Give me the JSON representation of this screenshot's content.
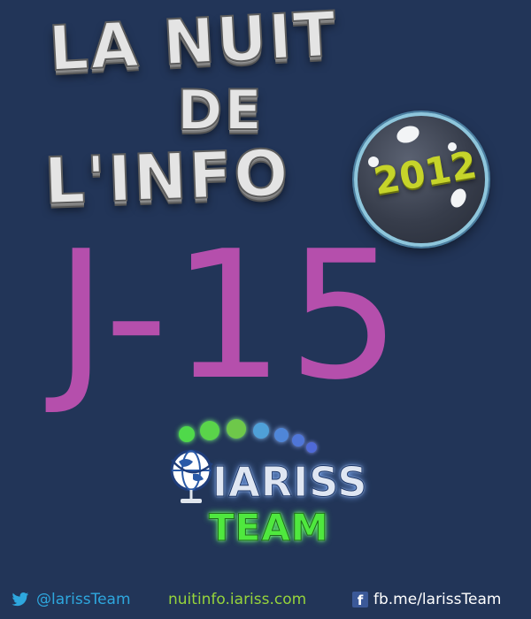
{
  "title": {
    "line1": "LA NUIT",
    "line2": "DE",
    "line3": "L'INFO",
    "year": "2012"
  },
  "countdown": "J-15",
  "logo": {
    "brand": "IARISS",
    "team": "TEAM"
  },
  "footer": {
    "twitter": "@larissTeam",
    "website": "nuitinfo.iariss.com",
    "facebook": "fb.me/larissTeam"
  },
  "colors": {
    "background": "#223558",
    "countdown": "#b54fac",
    "year": "#c6d42a",
    "team": "#4fe83e",
    "twitter": "#2ea7de",
    "website": "#96d43b"
  },
  "icons": [
    "twitter-icon",
    "facebook-icon",
    "globe-icon"
  ]
}
